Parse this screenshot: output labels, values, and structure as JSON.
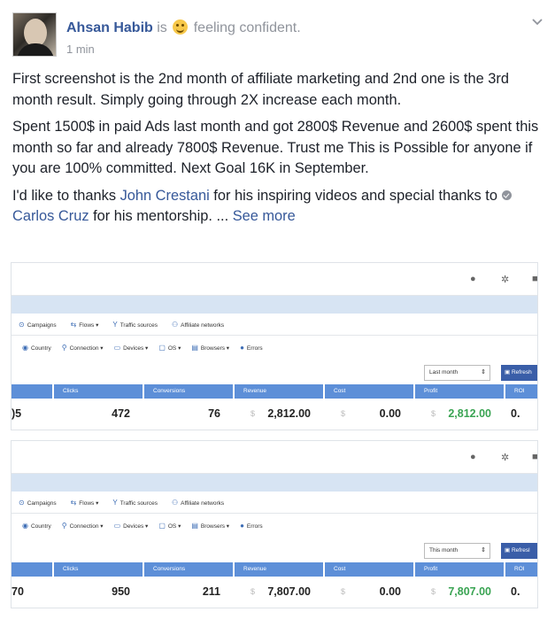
{
  "post": {
    "author": "Ahsan Habib",
    "is_word": "is",
    "feeling": "feeling confident.",
    "time": "1 min",
    "p1": "First screenshot is the 2nd month of affiliate marketing and 2nd one is the 3rd month result. Simply going through 2X increase each month.",
    "p2": "Spent 1500$ in paid Ads last month and got 2800$ Revenue and 2600$ spent this month so far and already 7800$ Revenue. Trust me This is Possible for anyone if you are 100% committed. Next Goal 16K in September.",
    "p3_a": "I'd like to thanks ",
    "p3_link1": "John Crestani",
    "p3_b": " for his inspiring videos and special thanks to ",
    "p3_link2": "Carlos Cruz",
    "p3_c": " for his mentorship. ... ",
    "see_more": "See more"
  },
  "icons": {
    "emoji": "smiley-emoji-icon",
    "chevron": "chevron-down-icon",
    "help": "help-icon",
    "settings": "gear-icon",
    "verified": "verified-badge-icon"
  },
  "dashboard_nav": {
    "tabs": [
      "Campaigns",
      "Flows ▾",
      "Traffic sources",
      "Affiliate networks"
    ],
    "filters": [
      "Country",
      "Connection ▾",
      "Devices ▾",
      "OS ▾",
      "Browsers ▾",
      "Errors"
    ],
    "refresh": "Refresh",
    "refresh_short": "Refresl"
  },
  "screenshot1": {
    "range": "Last month",
    "headers": [
      "",
      "Clicks",
      "Conversions",
      "Revenue",
      "Cost",
      "Profit",
      "ROI"
    ],
    "values": [
      ")5",
      "472",
      "76",
      "2,812.00",
      "0.00",
      "2,812.00",
      "0."
    ]
  },
  "screenshot2": {
    "range": "This month",
    "headers": [
      "",
      "Clicks",
      "Conversions",
      "Revenue",
      "Cost",
      "Profit",
      "ROI"
    ],
    "values": [
      "70",
      "950",
      "211",
      "7,807.00",
      "0.00",
      "7,807.00",
      "0."
    ]
  },
  "colors": {
    "link": "#365899",
    "header_blue": "#5d8fd8",
    "profit_green": "#3aa453"
  }
}
